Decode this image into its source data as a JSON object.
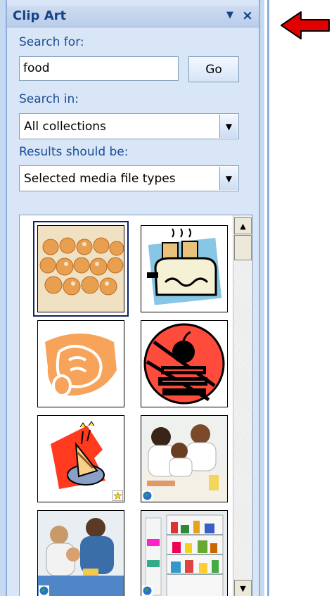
{
  "task_pane": {
    "title": "Clip Art",
    "menu_icon": "dropdown-triangle-icon",
    "close_symbol": "×"
  },
  "search": {
    "label": "Search for:",
    "value": "food",
    "go_label": "Go"
  },
  "search_in": {
    "label": "Search in:",
    "selected": "All collections"
  },
  "results_type": {
    "label": "Results should be:",
    "selected": "Selected media file types"
  },
  "results": [
    {
      "name": "cupcakes-photo",
      "kind": "photo",
      "selected": true
    },
    {
      "name": "toaster-clipart",
      "kind": "clipart"
    },
    {
      "name": "cornucopia-clipart",
      "kind": "clipart"
    },
    {
      "name": "apple-books-clipart",
      "kind": "clipart"
    },
    {
      "name": "birthday-cake-clipart",
      "kind": "clipart",
      "badge": "star-badge-icon"
    },
    {
      "name": "family-kitchen-photo",
      "kind": "photo",
      "badge": "globe-badge-icon"
    },
    {
      "name": "family-meal-photo",
      "kind": "photo",
      "badge": "globe-badge-icon"
    },
    {
      "name": "refrigerator-photo",
      "kind": "photo",
      "badge": "globe-badge-icon"
    }
  ],
  "annotation": {
    "icon": "red-arrow-icon",
    "color": "#e00000"
  },
  "colors": {
    "label_text": "#1a4e94",
    "title_text": "#15428b",
    "pane_bg": "#d9e6f7"
  }
}
